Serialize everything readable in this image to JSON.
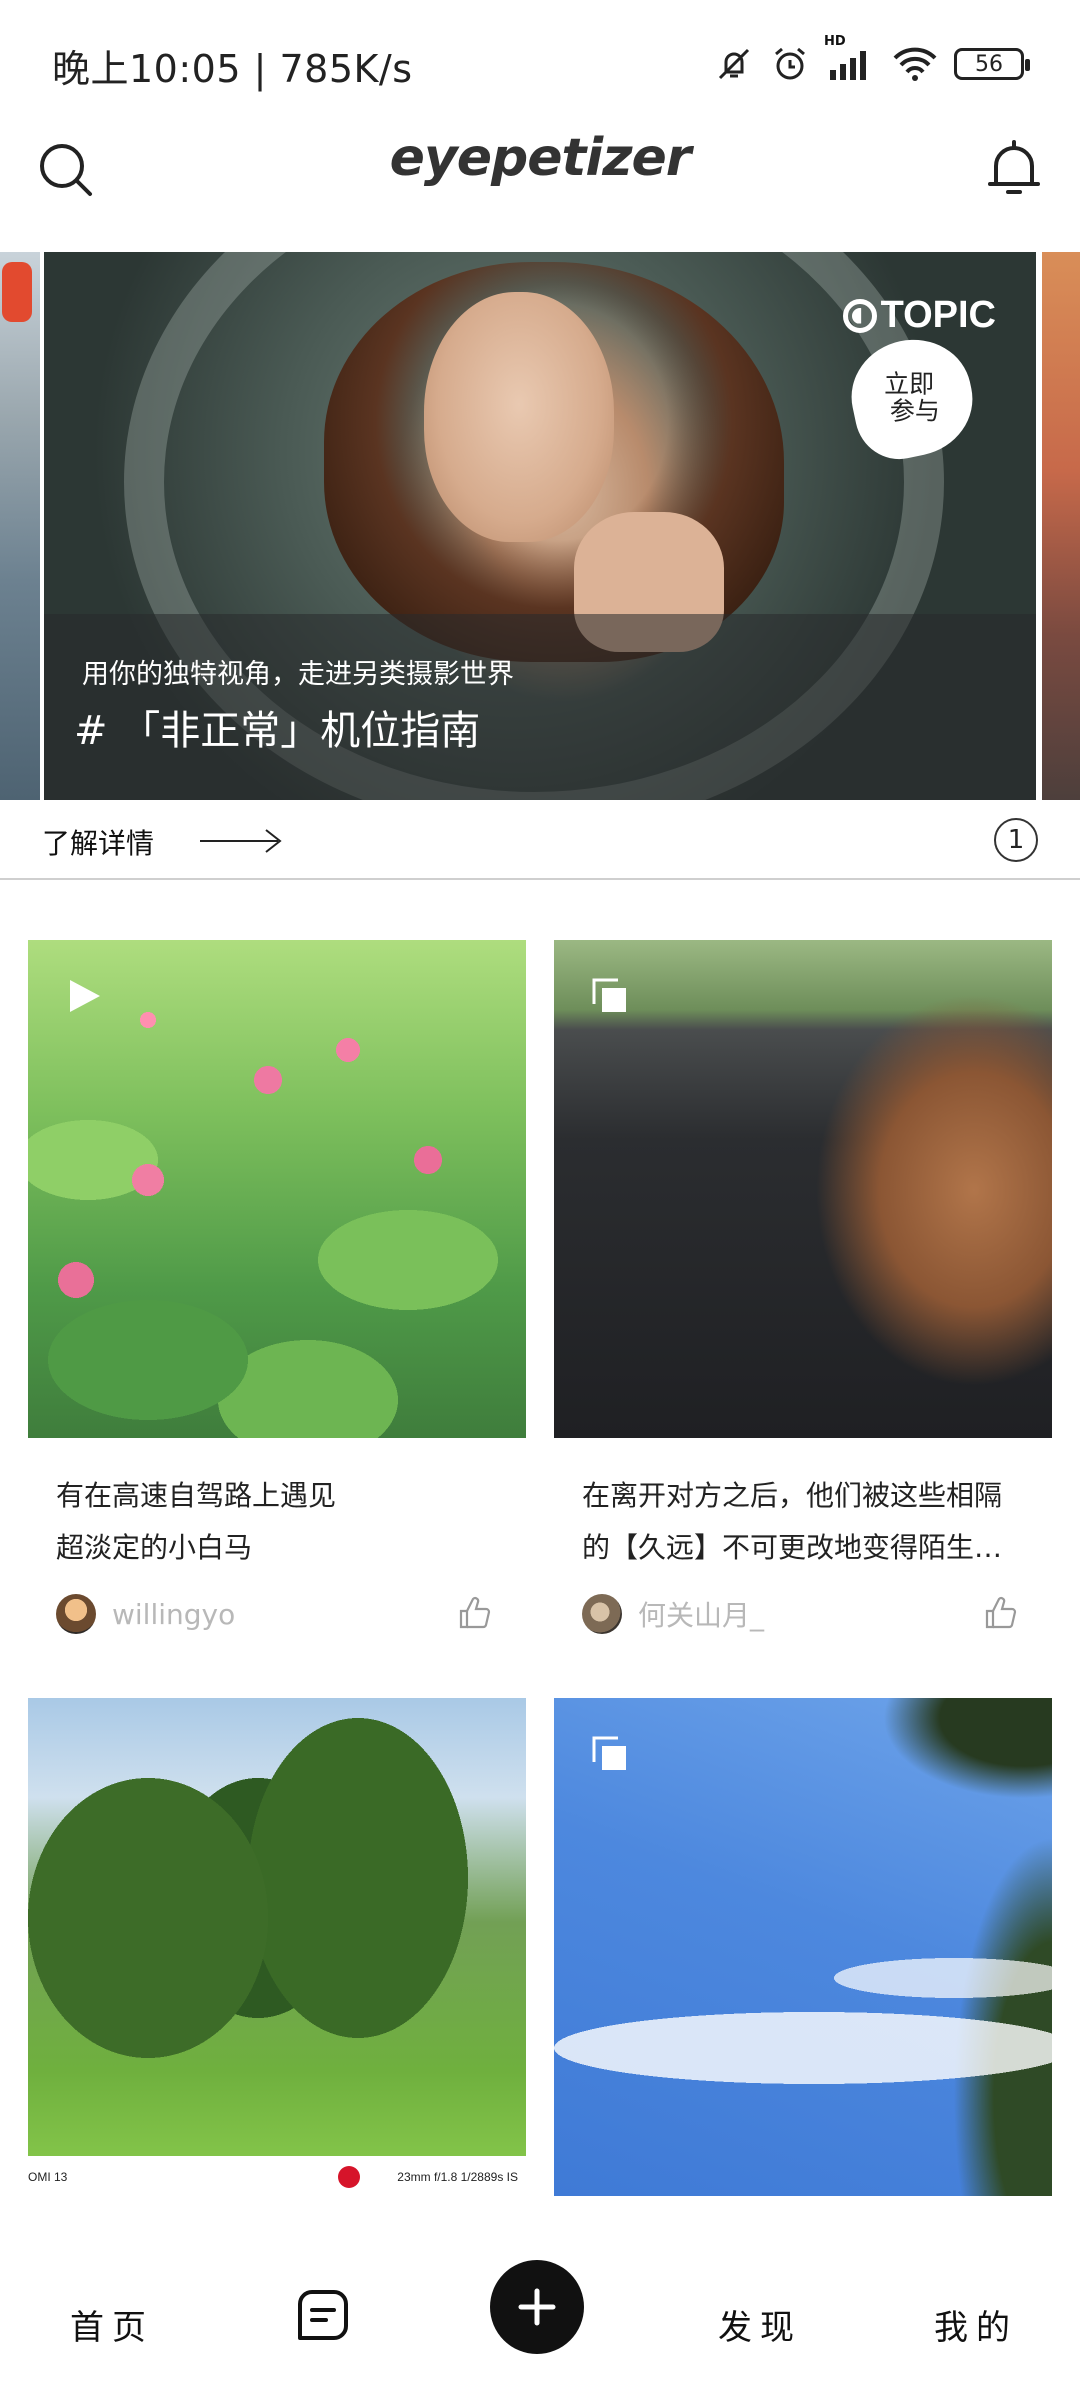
{
  "status_bar": {
    "time": "晚上10:05 | 785K/s",
    "battery": "56",
    "hd": "HD",
    "icons": [
      "mute-bell-icon",
      "alarm-icon",
      "signal-icon",
      "wifi-icon",
      "battery-icon"
    ]
  },
  "header": {
    "logo": "eyepetizer",
    "left_icon": "search-icon",
    "right_icon": "bell-icon"
  },
  "banner": {
    "subtitle": "用你的独特视角，走进另类摄影世界",
    "title": "# 「非正常」机位指南",
    "badge": "TOPIC",
    "join_line1": "立即",
    "join_line2": "参与",
    "detail_label": "了解详情",
    "page_number": "1"
  },
  "feed": {
    "cards": [
      {
        "title_line1": "有在高速自驾路上遇见",
        "title_line2": "超淡定的小白马",
        "author": "willingyo",
        "overlay": "play-icon"
      },
      {
        "title_line1": "在离开对方之后，他们被这些相隔",
        "title_line2": "的【久远】不可更改地变得陌生…",
        "author": "何关山月_",
        "overlay": "multi-image-icon"
      },
      {
        "exif_left": "OMI 13",
        "exif_right": "23mm  f/1.8  1/2889s  IS"
      },
      {
        "overlay": "multi-image-icon"
      }
    ]
  },
  "bottom_nav": {
    "home": "首页",
    "discover": "发现",
    "mine": "我的",
    "message_icon": "message-icon",
    "add_icon": "plus-icon"
  },
  "colors": {
    "accent": "#111111",
    "muted_text": "#b8b8b8",
    "divider": "#cfcfcf"
  }
}
